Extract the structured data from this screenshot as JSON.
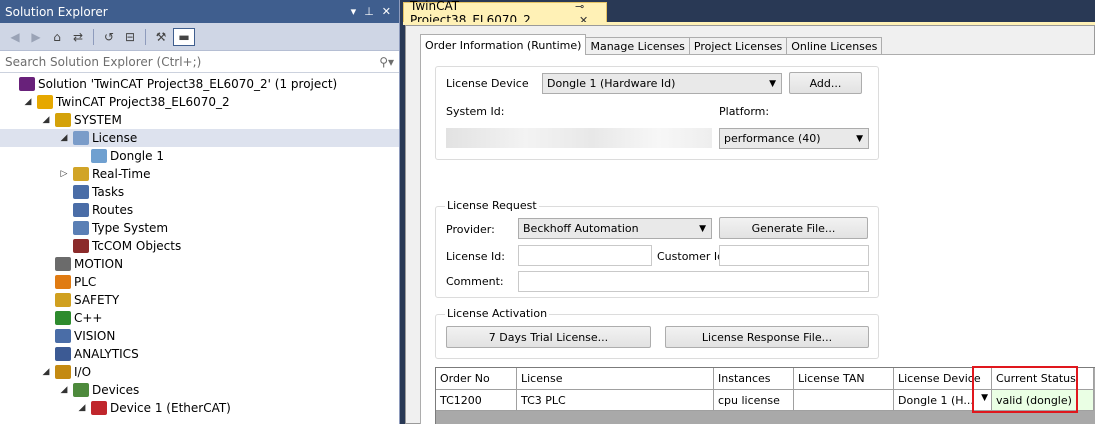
{
  "solution_explorer": {
    "title": "Solution Explorer",
    "title_buttons": [
      "▾",
      "⊥",
      "✕"
    ],
    "search_placeholder": "Search Solution Explorer (Ctrl+;)",
    "tree": [
      {
        "label": "Solution 'TwinCAT Project38_EL6070_2' (1 project)",
        "icon": "solution-icon",
        "depth": 0,
        "expander": ""
      },
      {
        "label": "TwinCAT Project38_EL6070_2",
        "icon": "twincat-project-icon",
        "depth": 1,
        "expander": "◢"
      },
      {
        "label": "SYSTEM",
        "icon": "system-icon",
        "depth": 2,
        "expander": "◢"
      },
      {
        "label": "License",
        "icon": "license-icon",
        "depth": 3,
        "expander": "◢",
        "selected": true
      },
      {
        "label": "Dongle 1",
        "icon": "dongle-icon",
        "depth": 4,
        "expander": ""
      },
      {
        "label": "Real-Time",
        "icon": "realtime-icon",
        "depth": 3,
        "expander": "▷"
      },
      {
        "label": "Tasks",
        "icon": "tasks-icon",
        "depth": 3,
        "expander": ""
      },
      {
        "label": "Routes",
        "icon": "routes-icon",
        "depth": 3,
        "expander": ""
      },
      {
        "label": "Type System",
        "icon": "type-system-icon",
        "depth": 3,
        "expander": ""
      },
      {
        "label": "TcCOM Objects",
        "icon": "tccom-icon",
        "depth": 3,
        "expander": ""
      },
      {
        "label": "MOTION",
        "icon": "motion-icon",
        "depth": 2,
        "expander": ""
      },
      {
        "label": "PLC",
        "icon": "plc-icon",
        "depth": 2,
        "expander": ""
      },
      {
        "label": "SAFETY",
        "icon": "safety-icon",
        "depth": 2,
        "expander": ""
      },
      {
        "label": "C++",
        "icon": "cpp-icon",
        "depth": 2,
        "expander": ""
      },
      {
        "label": "VISION",
        "icon": "vision-icon",
        "depth": 2,
        "expander": ""
      },
      {
        "label": "ANALYTICS",
        "icon": "analytics-icon",
        "depth": 2,
        "expander": ""
      },
      {
        "label": "I/O",
        "icon": "io-icon",
        "depth": 2,
        "expander": "◢"
      },
      {
        "label": "Devices",
        "icon": "devices-icon",
        "depth": 3,
        "expander": "◢"
      },
      {
        "label": "Device 1 (EtherCAT)",
        "icon": "ethercat-device-icon",
        "depth": 4,
        "expander": "◢"
      }
    ]
  },
  "document": {
    "tab_title": "TwinCAT Project38_EL6070_2",
    "tab_pin": "⊸",
    "tab_close": "✕",
    "inner_tabs": [
      "Order Information (Runtime)",
      "Manage Licenses",
      "Project Licenses",
      "Online Licenses"
    ],
    "license_device_group": {
      "license_device_label": "License Device",
      "license_device_value": "Dongle 1 (Hardware Id)",
      "add_button": "Add...",
      "system_id_label": "System Id:",
      "platform_label": "Platform:",
      "platform_value": "performance (40)"
    },
    "license_request_group": {
      "title": "License Request",
      "provider_label": "Provider:",
      "provider_value": "Beckhoff Automation",
      "generate_button": "Generate File...",
      "license_id_label": "License Id:",
      "customer_id_label": "Customer Id:",
      "comment_label": "Comment:"
    },
    "license_activation_group": {
      "title": "License Activation",
      "trial_button": "7 Days Trial License...",
      "response_button": "License Response File..."
    },
    "grid": {
      "headers": [
        "Order No",
        "License",
        "Instances",
        "License TAN",
        "License Device",
        "Current Status"
      ],
      "rows": [
        [
          "TC1200",
          "TC3 PLC",
          "cpu license",
          "",
          "Dongle 1 (H...",
          "valid (dongle)"
        ]
      ]
    }
  },
  "colors": {
    "highlight_box": "#e0171d",
    "title_bar": "#3f5e8e",
    "active_doc_tab": "#fff1b6"
  }
}
